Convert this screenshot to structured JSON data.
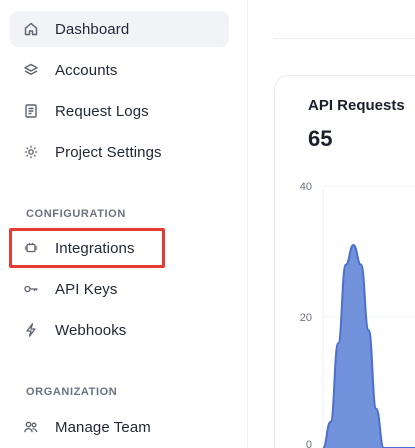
{
  "sidebar": {
    "items": [
      {
        "label": "Dashboard",
        "icon": "home-icon",
        "active": true
      },
      {
        "label": "Accounts",
        "icon": "layers-icon"
      },
      {
        "label": "Request Logs",
        "icon": "document-icon"
      },
      {
        "label": "Project Settings",
        "icon": "gear-icon"
      }
    ],
    "configuration_title": "CONFIGURATION",
    "configuration_items": [
      {
        "label": "Integrations",
        "icon": "plug-icon"
      },
      {
        "label": "API Keys",
        "icon": "key-icon"
      },
      {
        "label": "Webhooks",
        "icon": "bolt-icon"
      }
    ],
    "organization_title": "ORGANIZATION",
    "organization_items": [
      {
        "label": "Manage Team",
        "icon": "team-icon"
      }
    ]
  },
  "highlight_color": "#e53935",
  "card": {
    "title": "API Requests",
    "value": "65"
  },
  "chart_data": {
    "type": "area",
    "yticks": [
      "40",
      "20",
      "0"
    ],
    "ylim": [
      0,
      40
    ],
    "series": [
      {
        "x": [
          0,
          1,
          2,
          3,
          4,
          5,
          6,
          7,
          8,
          9,
          10,
          11,
          12,
          13,
          14
        ],
        "values": [
          0,
          4,
          16,
          28,
          31,
          28,
          18,
          6,
          0,
          0,
          0,
          0,
          0,
          0,
          0
        ],
        "color": "#5b7fd6"
      }
    ]
  }
}
